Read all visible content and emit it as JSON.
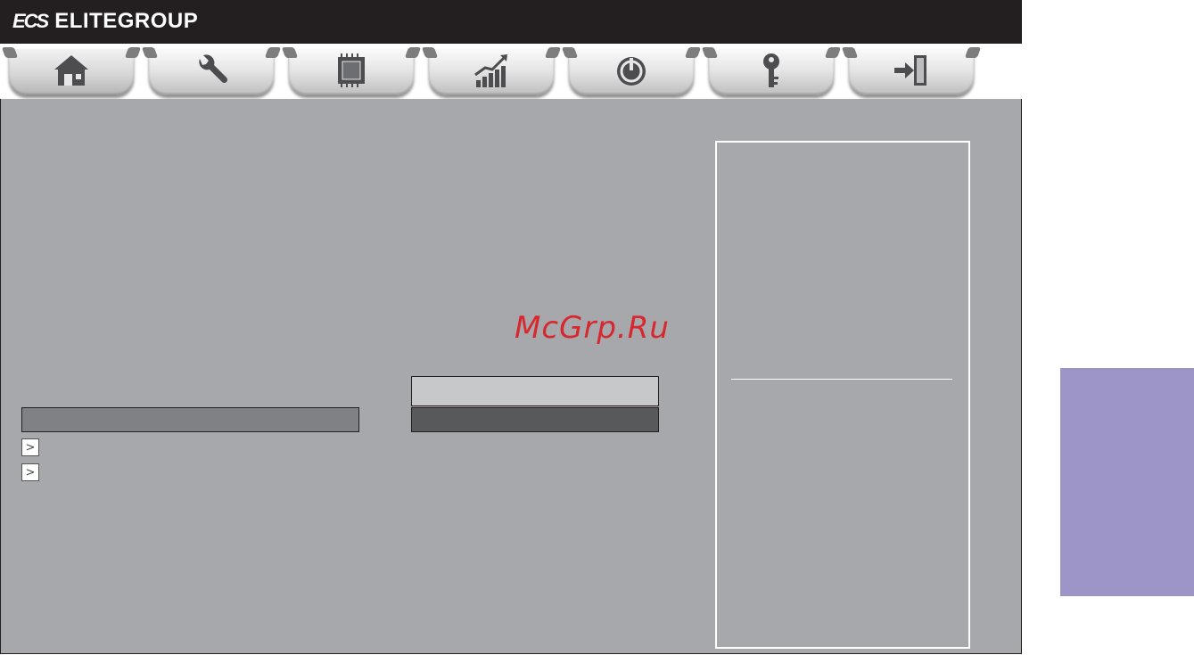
{
  "header": {
    "brand_mark": "ECS",
    "brand_name": "ELITEGROUP"
  },
  "tabs": [
    {
      "icon": "home-icon"
    },
    {
      "icon": "wrench-icon"
    },
    {
      "icon": "chip-icon"
    },
    {
      "icon": "performance-chart-icon"
    },
    {
      "icon": "power-icon"
    },
    {
      "icon": "key-icon"
    },
    {
      "icon": "exit-icon"
    }
  ],
  "watermark": "McGrp.Ru",
  "submenu": {
    "arrow_glyph": ">"
  },
  "colors": {
    "header_bg": "#231f20",
    "panel_bg": "#a7a8ab",
    "watermark": "#d7282f",
    "side_tab": "#9d94c8"
  }
}
